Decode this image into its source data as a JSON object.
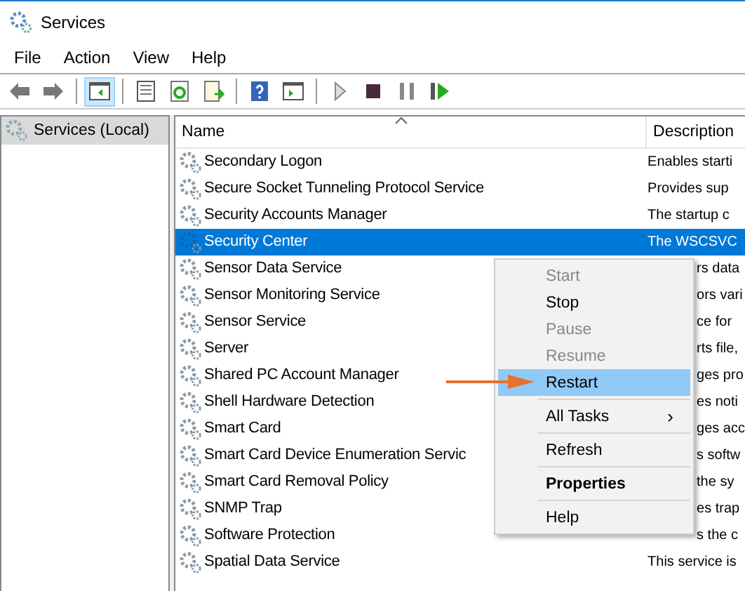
{
  "window": {
    "title": "Services"
  },
  "menu_bar": [
    "File",
    "Action",
    "View",
    "Help"
  ],
  "toolbar": [
    {
      "kind": "back",
      "selected": false
    },
    {
      "kind": "forward",
      "selected": false
    },
    {
      "kind": "sep"
    },
    {
      "kind": "console-tree",
      "selected": true
    },
    {
      "kind": "sep"
    },
    {
      "kind": "properties",
      "selected": false
    },
    {
      "kind": "refresh",
      "selected": false
    },
    {
      "kind": "export",
      "selected": false
    },
    {
      "kind": "sep"
    },
    {
      "kind": "help",
      "selected": false
    },
    {
      "kind": "action-pane",
      "selected": false
    },
    {
      "kind": "sep"
    },
    {
      "kind": "play",
      "selected": false
    },
    {
      "kind": "stop",
      "selected": false
    },
    {
      "kind": "pause",
      "selected": false
    },
    {
      "kind": "resume",
      "selected": false
    }
  ],
  "sidebar": {
    "items": [
      {
        "label": "Services (Local)",
        "selected": true
      }
    ]
  },
  "table": {
    "columns": [
      "Name",
      "Description"
    ],
    "rows": [
      {
        "name": "Secondary Logon",
        "description": "Enables starti",
        "covered": false,
        "selected": false
      },
      {
        "name": "Secure Socket Tunneling Protocol Service",
        "description": "Provides sup",
        "covered": false,
        "selected": false
      },
      {
        "name": "Security Accounts Manager",
        "description": "The startup c",
        "covered": false,
        "selected": false
      },
      {
        "name": "Security Center",
        "description": "The WSCSVC",
        "covered": false,
        "selected": true
      },
      {
        "name": "Sensor Data Service",
        "description": "rs data",
        "covered": true,
        "selected": false
      },
      {
        "name": "Sensor Monitoring Service",
        "description": "ors vari",
        "covered": true,
        "selected": false
      },
      {
        "name": "Sensor Service",
        "description": "ce for",
        "covered": true,
        "selected": false
      },
      {
        "name": "Server",
        "description": "rts file,",
        "covered": true,
        "selected": false
      },
      {
        "name": "Shared PC Account Manager",
        "description": "ges pro",
        "covered": true,
        "selected": false
      },
      {
        "name": "Shell Hardware Detection",
        "description": "es noti",
        "covered": true,
        "selected": false
      },
      {
        "name": "Smart Card",
        "description": "ges acc",
        "covered": true,
        "selected": false
      },
      {
        "name": "Smart Card Device Enumeration Servic",
        "description": "s softw",
        "covered": true,
        "selected": false
      },
      {
        "name": "Smart Card Removal Policy",
        "description": "the sy",
        "covered": true,
        "selected": false
      },
      {
        "name": "SNMP Trap",
        "description": "es trap",
        "covered": true,
        "selected": false
      },
      {
        "name": "Software Protection",
        "description": "s the c",
        "covered": true,
        "selected": false
      },
      {
        "name": "Spatial Data Service",
        "description": "This service is",
        "covered": false,
        "selected": false
      }
    ]
  },
  "context_menu": {
    "items": [
      {
        "kind": "item",
        "label": "Start",
        "disabled": true,
        "selected": false
      },
      {
        "kind": "item",
        "label": "Stop",
        "disabled": false,
        "selected": false
      },
      {
        "kind": "item",
        "label": "Pause",
        "disabled": true,
        "selected": false
      },
      {
        "kind": "item",
        "label": "Resume",
        "disabled": true,
        "selected": false
      },
      {
        "kind": "item",
        "label": "Restart",
        "disabled": false,
        "selected": true
      },
      {
        "kind": "sep"
      },
      {
        "kind": "submenu",
        "label": "All Tasks",
        "arrow": "›",
        "disabled": false,
        "selected": false
      },
      {
        "kind": "sep"
      },
      {
        "kind": "item",
        "label": "Refresh",
        "disabled": false,
        "selected": false
      },
      {
        "kind": "sep"
      },
      {
        "kind": "default",
        "label": "Properties",
        "disabled": false,
        "selected": false
      },
      {
        "kind": "sep"
      },
      {
        "kind": "item",
        "label": "Help",
        "disabled": false,
        "selected": false
      }
    ]
  }
}
